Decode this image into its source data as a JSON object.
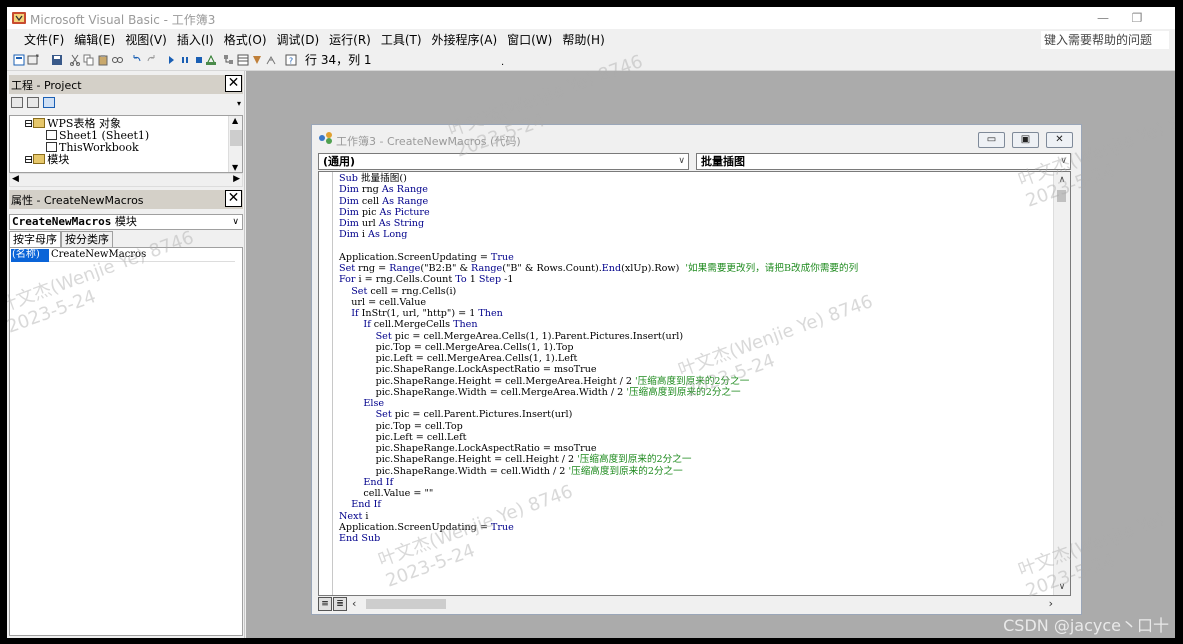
{
  "window": {
    "title": "Microsoft Visual Basic - 工作簿3"
  },
  "menus": [
    "文件(F)",
    "编辑(E)",
    "视图(V)",
    "插入(I)",
    "格式(O)",
    "调试(D)",
    "运行(R)",
    "工具(T)",
    "外接程序(A)",
    "窗口(W)",
    "帮助(H)"
  ],
  "help_box": {
    "placeholder": "键入需要帮助的问题"
  },
  "toolbar": {
    "position": "行 34，列 1",
    "dot": "."
  },
  "project": {
    "title": "工程 - Project",
    "tree": [
      "WPS表格 对象",
      "Sheet1 (Sheet1)",
      "ThisWorkbook",
      "模块"
    ]
  },
  "properties": {
    "title": "属性 - CreateNewMacros",
    "selector_name": "CreateNewMacros",
    "selector_type": "模块",
    "tabs": [
      "按字母序",
      "按分类序"
    ],
    "row_key": "(名称)",
    "row_value": "CreateNewMacros"
  },
  "code_window": {
    "title": "工作簿3 - CreateNewMacros (代码)",
    "object_combo": "(通用)",
    "proc_combo": "批量插图",
    "lines": [
      "Sub 批量插图()",
      "Dim rng As Range",
      "Dim cell As Range",
      "Dim pic As Picture",
      "Dim url As String",
      "Dim i As Long",
      "",
      "Application.ScreenUpdating = True",
      "Set rng = Range(\"B2:B\" & Range(\"B\" & Rows.Count).End(xlUp).Row)  '如果需要更改列，请把B改成你需要的列",
      "For i = rng.Cells.Count To 1 Step -1",
      "    Set cell = rng.Cells(i)",
      "    url = cell.Value",
      "    If InStr(1, url, \"http\") = 1 Then",
      "        If cell.MergeCells Then",
      "            Set pic = cell.MergeArea.Cells(1, 1).Parent.Pictures.Insert(url)",
      "            pic.Top = cell.MergeArea.Cells(1, 1).Top",
      "            pic.Left = cell.MergeArea.Cells(1, 1).Left",
      "            pic.ShapeRange.LockAspectRatio = msoTrue",
      "            pic.ShapeRange.Height = cell.MergeArea.Height / 2 '压缩高度到原来的2分之一",
      "            pic.ShapeRange.Width = cell.MergeArea.Width / 2 '压缩高度到原来的2分之一",
      "        Else",
      "            Set pic = cell.Parent.Pictures.Insert(url)",
      "            pic.Top = cell.Top",
      "            pic.Left = cell.Left",
      "            pic.ShapeRange.LockAspectRatio = msoTrue",
      "            pic.ShapeRange.Height = cell.Height / 2 '压缩高度到原来的2分之一",
      "            pic.ShapeRange.Width = cell.Width / 2 '压缩高度到原来的2分之一",
      "        End If",
      "        cell.Value = \"\"",
      "    End If",
      "Next i",
      "Application.ScreenUpdating = True",
      "End Sub"
    ]
  },
  "watermark": {
    "line1": "叶文杰(Wenjie Ye) 8746",
    "line2": "2023-5-24"
  },
  "csdn": "CSDN @jacyce丶口十",
  "colors": {
    "keyword": "#00008b",
    "comment": "#1f8b1f",
    "selection": "#0a64d8",
    "mdi_bg": "#ababab"
  }
}
